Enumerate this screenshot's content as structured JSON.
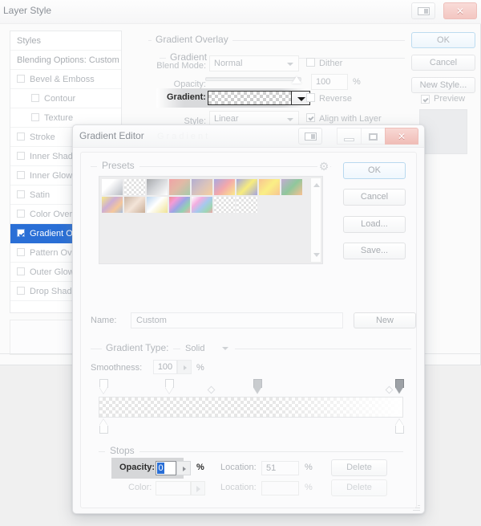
{
  "layer_style": {
    "title": "Layer Style",
    "titlebar_buttons": [
      {
        "name": "layout-icon",
        "label": ""
      },
      {
        "name": "close",
        "label": "✕"
      }
    ],
    "styles_list": [
      {
        "label": "Styles",
        "type": "header",
        "checkbox": false,
        "indent": false,
        "selected": false
      },
      {
        "label": "Blending Options: Custom",
        "type": "header",
        "checkbox": false,
        "indent": false,
        "selected": false
      },
      {
        "label": "Bevel & Emboss",
        "type": "item",
        "checkbox": true,
        "checked": false,
        "indent": false,
        "selected": false
      },
      {
        "label": "Contour",
        "type": "item",
        "checkbox": true,
        "checked": false,
        "indent": true,
        "selected": false
      },
      {
        "label": "Texture",
        "type": "item",
        "checkbox": true,
        "checked": false,
        "indent": true,
        "selected": false
      },
      {
        "label": "Stroke",
        "type": "item",
        "checkbox": true,
        "checked": false,
        "indent": false,
        "selected": false
      },
      {
        "label": "Inner Shadow",
        "type": "item",
        "checkbox": true,
        "checked": false,
        "indent": false,
        "selected": false
      },
      {
        "label": "Inner Glow",
        "type": "item",
        "checkbox": true,
        "checked": false,
        "indent": false,
        "selected": false
      },
      {
        "label": "Satin",
        "type": "item",
        "checkbox": true,
        "checked": false,
        "indent": false,
        "selected": false
      },
      {
        "label": "Color Overlay",
        "type": "item",
        "checkbox": true,
        "checked": false,
        "indent": false,
        "selected": false
      },
      {
        "label": "Gradient Overlay",
        "type": "item",
        "checkbox": true,
        "checked": true,
        "indent": false,
        "selected": true
      },
      {
        "label": "Pattern Overlay",
        "type": "item",
        "checkbox": true,
        "checked": false,
        "indent": false,
        "selected": false
      },
      {
        "label": "Outer Glow",
        "type": "item",
        "checkbox": true,
        "checked": false,
        "indent": false,
        "selected": false
      },
      {
        "label": "Drop Shadow",
        "type": "item",
        "checkbox": true,
        "checked": false,
        "indent": false,
        "selected": false
      }
    ],
    "gradient_overlay": {
      "group_label": "Gradient Overlay",
      "sub_group_label": "Gradient",
      "blend_mode_label": "Blend Mode:",
      "blend_mode_value": "Normal",
      "dither_label": "Dither",
      "dither_checked": false,
      "opacity_label": "Opacity:",
      "opacity_value": "100",
      "opacity_pct": "%",
      "gradient_label": "Gradient:",
      "reverse_label": "Reverse",
      "reverse_checked": false,
      "style_label": "Style:",
      "style_value": "Linear",
      "align_label": "Align with Layer",
      "align_checked": true
    },
    "buttons": {
      "ok": "OK",
      "cancel": "Cancel",
      "new_style": "New Style...",
      "preview_label": "Preview",
      "preview_checked": true
    }
  },
  "gradient_editor": {
    "title": "Gradient Editor",
    "ghost_text": "Gradient",
    "titlebar_buttons": {
      "layout": "",
      "minimize": "",
      "maximize": "",
      "close": "✕"
    },
    "presets": {
      "legend": "Presets",
      "gear_icon": "gear-icon",
      "swatches": [
        {
          "name": "foreground-to-background",
          "css": "linear-gradient(135deg,#ffffff 0%,#ffffff 35%,#b9bdc4 100%)"
        },
        {
          "name": "foreground-to-transparent",
          "css": "transparent"
        },
        {
          "name": "black-white",
          "css": "linear-gradient(135deg,#a7a9ad 0%,#d2d4d7 45%,#ffffff 100%)"
        },
        {
          "name": "red-green",
          "css": "linear-gradient(135deg,#f0a3a6 0%,#e2b9a6 45%,#a5cbab 100%)"
        },
        {
          "name": "violet-orange",
          "css": "linear-gradient(135deg,#b3aed2 0%,#d8c2bd 50%,#f6cf9e 100%)"
        },
        {
          "name": "blue-red-yellow",
          "css": "linear-gradient(135deg,#a9a9e0 0%,#f3a8ac 50%,#fbe98a 100%)"
        },
        {
          "name": "blue-yellow-blue",
          "css": "linear-gradient(135deg,#a6a6df 0%,#f7ec7e 50%,#a6a6df 100%)"
        },
        {
          "name": "orange-yellow-orange",
          "css": "linear-gradient(135deg,#f8c592 0%,#faef85 50%,#f8c592 100%)"
        },
        {
          "name": "violet-green-orange",
          "css": "linear-gradient(135deg,#c3acd3 0%,#8fc79c 50%,#f8c091 100%)"
        },
        {
          "name": "yellow-violet-orange-blue",
          "css": "linear-gradient(135deg,#f7ea87 0%,#cdaed4 40%,#f5c79a 70%,#a7bede 100%)"
        },
        {
          "name": "copper",
          "css": "linear-gradient(135deg,#cbb6a5 0%,#f3e4d8 50%,#c9ae97 100%)"
        },
        {
          "name": "chrome",
          "css": "linear-gradient(135deg,#bdd7ee 0%,#ffffff 45%,#f0e394 100%)"
        },
        {
          "name": "spectrum",
          "css": "linear-gradient(135deg,#f19095 0%,#f39bd6 25%,#9ea4e6 50%,#92d2b1 75%,#f3a8ac 100%)"
        },
        {
          "name": "transparent-rainbow",
          "css": "linear-gradient(135deg,#ffffff 0%,#f2aee0 30%,#a7c9ee 55%,#9ed6b4 80%,#f0a3a6 100%)"
        },
        {
          "name": "transparent-stripes",
          "css": "transparent"
        },
        {
          "name": "checker",
          "css": "transparent"
        }
      ],
      "scrollbar": {
        "up": "scroll-up-arrow",
        "down": "scroll-down-arrow"
      }
    },
    "buttons": {
      "ok": "OK",
      "cancel": "Cancel",
      "load": "Load...",
      "save": "Save..."
    },
    "name_label": "Name:",
    "name_value": "Custom",
    "new_button": "New",
    "gradient_type_label": "Gradient Type:",
    "gradient_type_value": "Solid",
    "smoothness_label": "Smoothness:",
    "smoothness_value": "100",
    "smoothness_pct": "%",
    "stops": {
      "legend": "Stops",
      "opacity_label": "Opacity:",
      "opacity_value": "0",
      "opacity_pct": "%",
      "location1_label": "Location:",
      "location1_value": "51",
      "location1_pct": "%",
      "delete1_button": "Delete",
      "color_label": "Color:",
      "color_value": "",
      "location2_label": "Location:",
      "location2_value": "",
      "location2_pct": "%",
      "delete2_button": "Delete"
    },
    "strip_stops": {
      "opacity_stops": [
        {
          "name": "opacity-stop-1",
          "left_pct": 0,
          "state": "empty"
        },
        {
          "name": "opacity-stop-2",
          "left_pct": 22,
          "state": "empty"
        },
        {
          "name": "opacity-stop-3",
          "left_pct": 51,
          "state": "filled"
        },
        {
          "name": "opacity-stop-4",
          "left_pct": 100,
          "state": "selected"
        }
      ],
      "opacity_midpoints": [
        {
          "left_pct": 36
        },
        {
          "left_pct": 96
        }
      ],
      "color_stops": [
        {
          "name": "color-stop-1",
          "left_pct": 0
        },
        {
          "name": "color-stop-2",
          "left_pct": 100
        }
      ]
    }
  }
}
